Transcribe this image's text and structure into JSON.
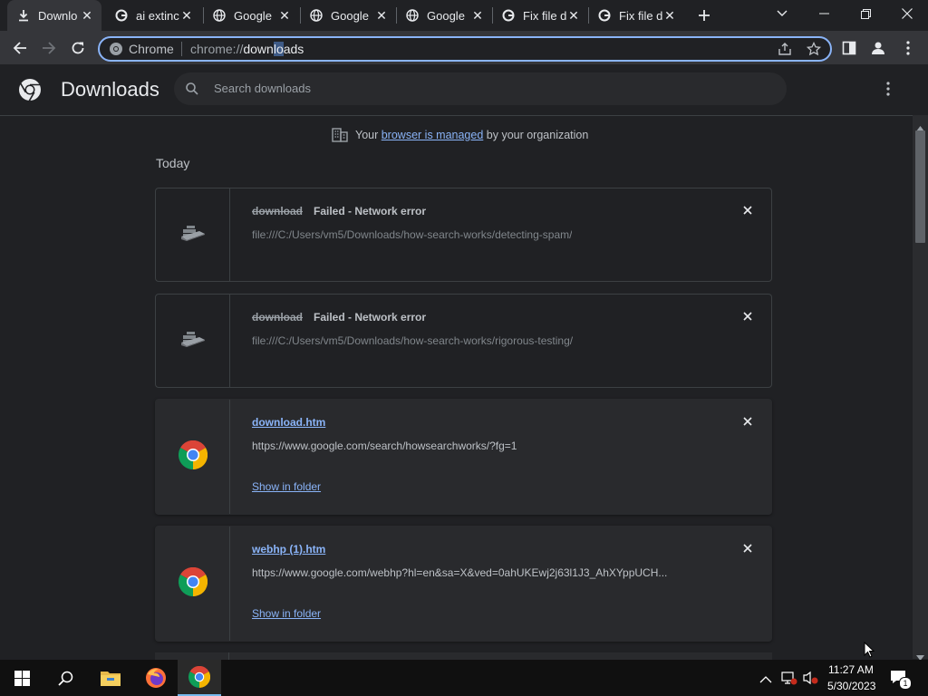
{
  "tabs": [
    {
      "title": "Downlo",
      "favicon": "download-icon",
      "active": true
    },
    {
      "title": "ai extinc",
      "favicon": "google-icon"
    },
    {
      "title": "Google",
      "favicon": "globe-icon"
    },
    {
      "title": "Google",
      "favicon": "globe-icon"
    },
    {
      "title": "Google",
      "favicon": "globe-icon"
    },
    {
      "title": "Fix file d",
      "favicon": "google-icon"
    },
    {
      "title": "Fix file d",
      "favicon": "google-icon"
    }
  ],
  "omnibox": {
    "site_label": "Chrome",
    "url_prefix": "chrome://",
    "url_host": "downloads",
    "url_selected": "lo"
  },
  "page": {
    "title": "Downloads",
    "search_placeholder": "Search downloads"
  },
  "managed": {
    "prefix": "Your ",
    "link": "browser is managed",
    "suffix": " by your organization"
  },
  "section_label": "Today",
  "downloads": [
    {
      "name": "download",
      "status": "Failed - Network error",
      "url": "file:///C:/Users/vm5/Downloads/how-search-works/detecting-spam/",
      "failed": true
    },
    {
      "name": "download",
      "status": "Failed - Network error",
      "url": "file:///C:/Users/vm5/Downloads/how-search-works/rigorous-testing/",
      "failed": true
    },
    {
      "name": "download.htm",
      "url": "https://www.google.com/search/howsearchworks/?fg=1",
      "action": "Show in folder",
      "failed": false
    },
    {
      "name": "webhp (1).htm",
      "url": "https://www.google.com/webhp?hl=en&sa=X&ved=0ahUKEwj2j63l1J3_AhXYppUCH...",
      "action": "Show in folder",
      "failed": false
    }
  ],
  "taskbar": {
    "time": "11:27 AM",
    "date": "5/30/2023",
    "notifications": "1"
  },
  "colors": {
    "accent": "#8ab4f8",
    "background": "#202124",
    "toolbar": "#35363a"
  }
}
